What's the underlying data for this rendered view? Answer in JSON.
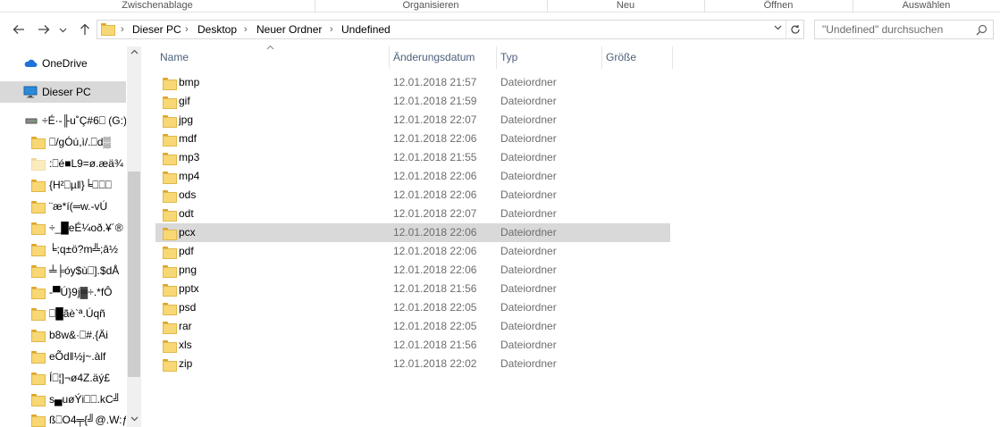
{
  "ribbon": {
    "groups": [
      "Zwischenablage",
      "Organisieren",
      "Neu",
      "Öffnen",
      "Auswählen"
    ]
  },
  "nav": {
    "back_icon": "arrow-left-icon",
    "forward_icon": "arrow-right-icon",
    "recent_icon": "chevron-down-icon",
    "up_icon": "arrow-up-icon",
    "breadcrumbs": [
      "Dieser PC",
      "Desktop",
      "Neuer Ordner",
      "Undefined"
    ],
    "search_placeholder": "\"Undefined\" durchsuchen"
  },
  "sidebar": {
    "items": [
      {
        "label": "OneDrive",
        "icon": "cloud-icon",
        "selected": false
      },
      {
        "label": "Dieser PC",
        "icon": "monitor-icon",
        "selected": true
      },
      {
        "label": "÷É·-╟u˚Ç#6⎕ (G:)",
        "icon": "drive-icon",
        "selected": false
      },
      {
        "label": "⎕/gÓú,ì/.⎕d▒",
        "icon": "folder-icon",
        "selected": false
      },
      {
        "label": ":⎕é■L9=ø.æä¾",
        "icon": "folder-icon",
        "selected": false
      },
      {
        "label": "{H²⎕µ‖}╘⎕⎕⎕",
        "icon": "folder-icon",
        "selected": false
      },
      {
        "label": "¨æ*í(═w.-vÚ",
        "icon": "folder-icon",
        "selected": false
      },
      {
        "label": "÷_█eÉ¼oð.¥´®",
        "icon": "folder-icon",
        "selected": false
      },
      {
        "label": "╘;q±ö?m╩;â½",
        "icon": "folder-icon",
        "selected": false
      },
      {
        "label": "╧╞óy$ù⎕].$dÅ",
        "icon": "folder-icon",
        "selected": false
      },
      {
        "label": "-▀Ú}9j▓÷.*fÔ",
        "icon": "folder-icon",
        "selected": false
      },
      {
        "label": "⎕█ãè`ª.Úqñ",
        "icon": "folder-icon",
        "selected": false
      },
      {
        "label": "b8w&·⎕#.{Äi",
        "icon": "folder-icon",
        "selected": false
      },
      {
        "label": "eÕd‖½j~.àlf",
        "icon": "folder-icon",
        "selected": false
      },
      {
        "label": "Í⎕¦]¬ø4Z.äý£",
        "icon": "folder-icon",
        "selected": false
      },
      {
        "label": "s▄uøÝi⎕⎕.kC╝",
        "icon": "folder-icon",
        "selected": false
      },
      {
        "label": "ß⎕O4╤{╝@.W:ƒ",
        "icon": "folder-icon",
        "selected": false
      }
    ]
  },
  "columns": {
    "name": "Name",
    "date": "Änderungsdatum",
    "type": "Typ",
    "size": "Größe"
  },
  "files": [
    {
      "name": "bmp",
      "date": "12.01.2018 21:57",
      "type": "Dateiordner"
    },
    {
      "name": "gif",
      "date": "12.01.2018 21:59",
      "type": "Dateiordner"
    },
    {
      "name": "jpg",
      "date": "12.01.2018 22:07",
      "type": "Dateiordner"
    },
    {
      "name": "mdf",
      "date": "12.01.2018 22:06",
      "type": "Dateiordner"
    },
    {
      "name": "mp3",
      "date": "12.01.2018 21:55",
      "type": "Dateiordner"
    },
    {
      "name": "mp4",
      "date": "12.01.2018 22:06",
      "type": "Dateiordner"
    },
    {
      "name": "ods",
      "date": "12.01.2018 22:06",
      "type": "Dateiordner"
    },
    {
      "name": "odt",
      "date": "12.01.2018 22:07",
      "type": "Dateiordner"
    },
    {
      "name": "pcx",
      "date": "12.01.2018 22:06",
      "type": "Dateiordner",
      "hover": true
    },
    {
      "name": "pdf",
      "date": "12.01.2018 22:06",
      "type": "Dateiordner"
    },
    {
      "name": "png",
      "date": "12.01.2018 22:06",
      "type": "Dateiordner"
    },
    {
      "name": "pptx",
      "date": "12.01.2018 21:56",
      "type": "Dateiordner"
    },
    {
      "name": "psd",
      "date": "12.01.2018 22:05",
      "type": "Dateiordner"
    },
    {
      "name": "rar",
      "date": "12.01.2018 22:05",
      "type": "Dateiordner"
    },
    {
      "name": "xls",
      "date": "12.01.2018 21:56",
      "type": "Dateiordner"
    },
    {
      "name": "zip",
      "date": "12.01.2018 22:02",
      "type": "Dateiordner"
    }
  ],
  "colors": {
    "selection": "#d9d9d9",
    "header_text": "#4c607a",
    "folder_fill": "#f8d775"
  }
}
